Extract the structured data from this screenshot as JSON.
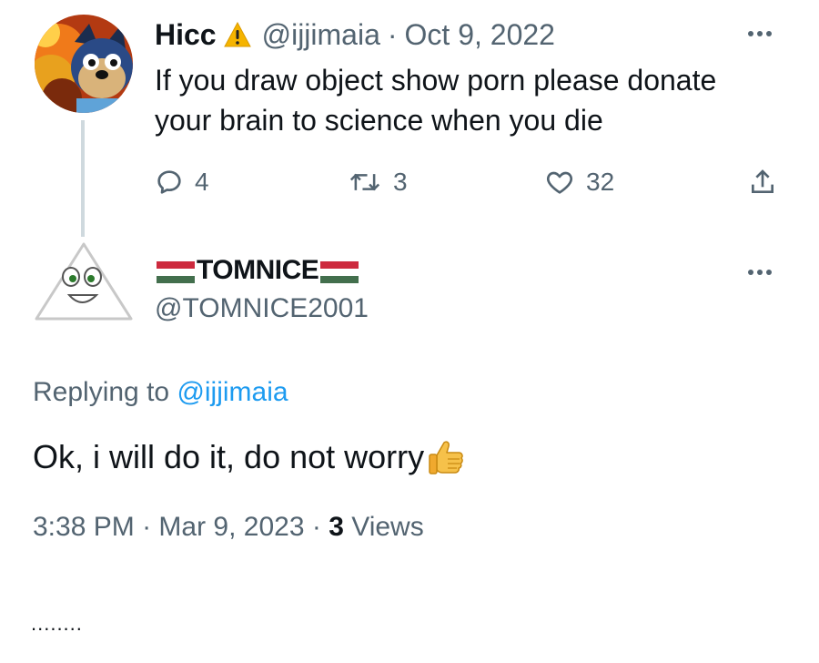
{
  "parent_tweet": {
    "display_name": "Hicc",
    "warning_icon": "warning-icon",
    "handle": "@ijjimaia",
    "separator": "·",
    "date": "Oct 9, 2022",
    "text": "If you draw object show porn please donate your brain to science when you die",
    "reply_count": "4",
    "retweet_count": "3",
    "like_count": "32",
    "more_icon": "more-icon"
  },
  "reply_tweet": {
    "display_name": "TOMNICE",
    "flag_icon": "hungary-flag-icon",
    "handle": "@TOMNICE2001",
    "replying_prefix": "Replying to",
    "replying_to": "@ijjimaia",
    "text": "Ok, i will do it, do not worry",
    "emoji": "thumbs-up-icon",
    "time": "3:38 PM",
    "separator": "·",
    "date": "Mar 9, 2023",
    "views_count": "3",
    "views_label": "Views"
  },
  "trailing_text": "........",
  "colors": {
    "text": "#0f1419",
    "muted": "#536471",
    "link": "#1d9bf0",
    "thread_line": "#cfd9de"
  }
}
